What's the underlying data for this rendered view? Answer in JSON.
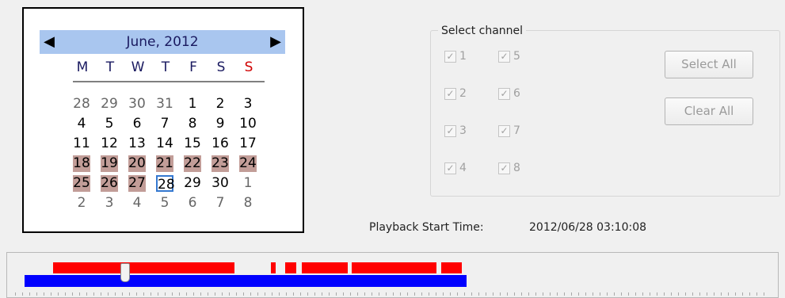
{
  "calendar": {
    "month_label": "June, 2012",
    "prev_icon": "triangle-left-icon",
    "next_icon": "triangle-right-icon",
    "weekdays": [
      "M",
      "T",
      "W",
      "T",
      "F",
      "S",
      "S"
    ],
    "weeks": [
      [
        {
          "d": "28",
          "other": true
        },
        {
          "d": "29",
          "other": true
        },
        {
          "d": "30",
          "other": true
        },
        {
          "d": "31",
          "other": true
        },
        {
          "d": "1"
        },
        {
          "d": "2"
        },
        {
          "d": "3"
        }
      ],
      [
        {
          "d": "4"
        },
        {
          "d": "5"
        },
        {
          "d": "6"
        },
        {
          "d": "7"
        },
        {
          "d": "8"
        },
        {
          "d": "9"
        },
        {
          "d": "10"
        }
      ],
      [
        {
          "d": "11"
        },
        {
          "d": "12"
        },
        {
          "d": "13"
        },
        {
          "d": "14"
        },
        {
          "d": "15"
        },
        {
          "d": "16"
        },
        {
          "d": "17"
        }
      ],
      [
        {
          "d": "18",
          "rec": true
        },
        {
          "d": "19",
          "rec": true
        },
        {
          "d": "20",
          "rec": true
        },
        {
          "d": "21",
          "rec": true
        },
        {
          "d": "22",
          "rec": true
        },
        {
          "d": "23",
          "rec": true
        },
        {
          "d": "24",
          "rec": true
        }
      ],
      [
        {
          "d": "25",
          "rec": true
        },
        {
          "d": "26",
          "rec": true
        },
        {
          "d": "27",
          "rec": true
        },
        {
          "d": "28",
          "selected": true
        },
        {
          "d": "29"
        },
        {
          "d": "30"
        },
        {
          "d": "1",
          "other": true
        }
      ],
      [
        {
          "d": "2",
          "other": true
        },
        {
          "d": "3",
          "other": true
        },
        {
          "d": "4",
          "other": true
        },
        {
          "d": "5",
          "other": true
        },
        {
          "d": "6",
          "other": true
        },
        {
          "d": "7",
          "other": true
        },
        {
          "d": "8",
          "other": true
        }
      ]
    ],
    "selected_date": "28",
    "recording_highlight_color": "#c29d98",
    "sunday_color": "#d00000",
    "header_color": "#a9c6ef"
  },
  "channels": {
    "group_title": "Select channel",
    "items": [
      {
        "label": "1",
        "checked": true
      },
      {
        "label": "2",
        "checked": true
      },
      {
        "label": "3",
        "checked": true
      },
      {
        "label": "4",
        "checked": true
      },
      {
        "label": "5",
        "checked": true
      },
      {
        "label": "6",
        "checked": true
      },
      {
        "label": "7",
        "checked": true
      },
      {
        "label": "8",
        "checked": true
      }
    ],
    "select_all_label": "Select All",
    "clear_all_label": "Clear All",
    "enabled": false
  },
  "playback": {
    "label": "Playback Start Time:",
    "value": "2012/06/28 03:10:08"
  },
  "timeline": {
    "record_color": "#ff0000",
    "range_color": "#0000ff",
    "thumb_icon": "slider-thumb-icon"
  }
}
